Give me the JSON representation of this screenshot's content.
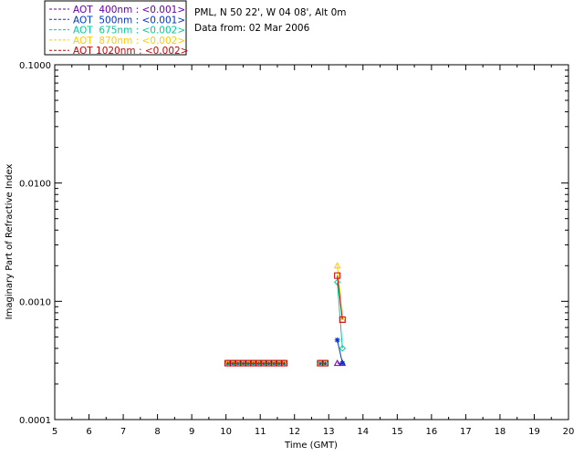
{
  "header": {
    "site": "PML, N 50 22', W 04 08', Alt 0m",
    "date": "Data from: 02 Mar 2006"
  },
  "chart_data": {
    "type": "line",
    "xlabel": "Time (GMT)",
    "ylabel": "Imaginary Part of Refractive Index",
    "xlim": [
      5,
      20
    ],
    "ylim": [
      0.0001,
      0.1
    ],
    "yscale": "log",
    "x_ticks": [
      "5",
      "6",
      "7",
      "8",
      "9",
      "10",
      "11",
      "12",
      "13",
      "14",
      "15",
      "16",
      "17",
      "18",
      "19",
      "20"
    ],
    "y_ticks": [
      "0.0001",
      "0.0010",
      "0.0100",
      "0.1000"
    ],
    "legend_position": "top-left, outside plot",
    "series": [
      {
        "name": "AOT  400nm : <0.001>",
        "color": "#6600aa",
        "marker": "triangle",
        "points": [
          [
            10.05,
            0.0003
          ],
          [
            10.2,
            0.0003
          ],
          [
            10.35,
            0.0003
          ],
          [
            10.5,
            0.0003
          ],
          [
            10.65,
            0.0003
          ],
          [
            10.8,
            0.0003
          ],
          [
            10.95,
            0.0003
          ],
          [
            11.1,
            0.0003
          ],
          [
            11.25,
            0.0003
          ],
          [
            11.4,
            0.0003
          ],
          [
            11.55,
            0.0003
          ],
          [
            11.7,
            0.0003
          ],
          [
            12.75,
            0.0003
          ],
          [
            12.9,
            0.0003
          ],
          [
            13.25,
            0.0003
          ],
          [
            13.4,
            0.0003
          ]
        ]
      },
      {
        "name": "AOT  500nm : <0.001>",
        "color": "#0033cc",
        "marker": "asterisk",
        "points": [
          [
            10.05,
            0.0003
          ],
          [
            10.2,
            0.0003
          ],
          [
            10.35,
            0.0003
          ],
          [
            10.5,
            0.0003
          ],
          [
            10.65,
            0.0003
          ],
          [
            10.8,
            0.0003
          ],
          [
            10.95,
            0.0003
          ],
          [
            11.1,
            0.0003
          ],
          [
            11.25,
            0.0003
          ],
          [
            11.4,
            0.0003
          ],
          [
            11.55,
            0.0003
          ],
          [
            11.7,
            0.0003
          ],
          [
            12.75,
            0.0003
          ],
          [
            12.9,
            0.0003
          ],
          [
            13.25,
            0.00047
          ],
          [
            13.4,
            0.0003
          ]
        ]
      },
      {
        "name": "AOT  675nm : <0.002>",
        "color": "#00cc99",
        "marker": "diamond",
        "points": [
          [
            10.05,
            0.0003
          ],
          [
            10.2,
            0.0003
          ],
          [
            10.35,
            0.0003
          ],
          [
            10.5,
            0.0003
          ],
          [
            10.65,
            0.0003
          ],
          [
            10.8,
            0.0003
          ],
          [
            10.95,
            0.0003
          ],
          [
            11.1,
            0.0003
          ],
          [
            11.25,
            0.0003
          ],
          [
            11.4,
            0.0003
          ],
          [
            11.55,
            0.0003
          ],
          [
            11.7,
            0.0003
          ],
          [
            12.75,
            0.0003
          ],
          [
            12.9,
            0.0003
          ],
          [
            13.25,
            0.00145
          ],
          [
            13.4,
            0.0004
          ]
        ]
      },
      {
        "name": "AOT  870nm : <0.002>",
        "color": "#ffcc00",
        "marker": "triangle",
        "points": [
          [
            10.05,
            0.0003
          ],
          [
            10.2,
            0.0003
          ],
          [
            10.35,
            0.0003
          ],
          [
            10.5,
            0.0003
          ],
          [
            10.65,
            0.0003
          ],
          [
            10.8,
            0.0003
          ],
          [
            10.95,
            0.0003
          ],
          [
            11.1,
            0.0003
          ],
          [
            11.25,
            0.0003
          ],
          [
            11.4,
            0.0003
          ],
          [
            11.55,
            0.0003
          ],
          [
            11.7,
            0.0003
          ],
          [
            12.75,
            0.0003
          ],
          [
            12.9,
            0.0003
          ],
          [
            13.25,
            0.002
          ],
          [
            13.4,
            0.0007
          ]
        ]
      },
      {
        "name": "AOT 1020nm : <0.002>",
        "color": "#cc0000",
        "marker": "square",
        "points": [
          [
            10.05,
            0.0003
          ],
          [
            10.2,
            0.0003
          ],
          [
            10.35,
            0.0003
          ],
          [
            10.5,
            0.0003
          ],
          [
            10.65,
            0.0003
          ],
          [
            10.8,
            0.0003
          ],
          [
            10.95,
            0.0003
          ],
          [
            11.1,
            0.0003
          ],
          [
            11.25,
            0.0003
          ],
          [
            11.4,
            0.0003
          ],
          [
            11.55,
            0.0003
          ],
          [
            11.7,
            0.0003
          ],
          [
            12.75,
            0.0003
          ],
          [
            12.9,
            0.0003
          ],
          [
            13.25,
            0.00165
          ],
          [
            13.4,
            0.0007
          ]
        ]
      }
    ]
  }
}
